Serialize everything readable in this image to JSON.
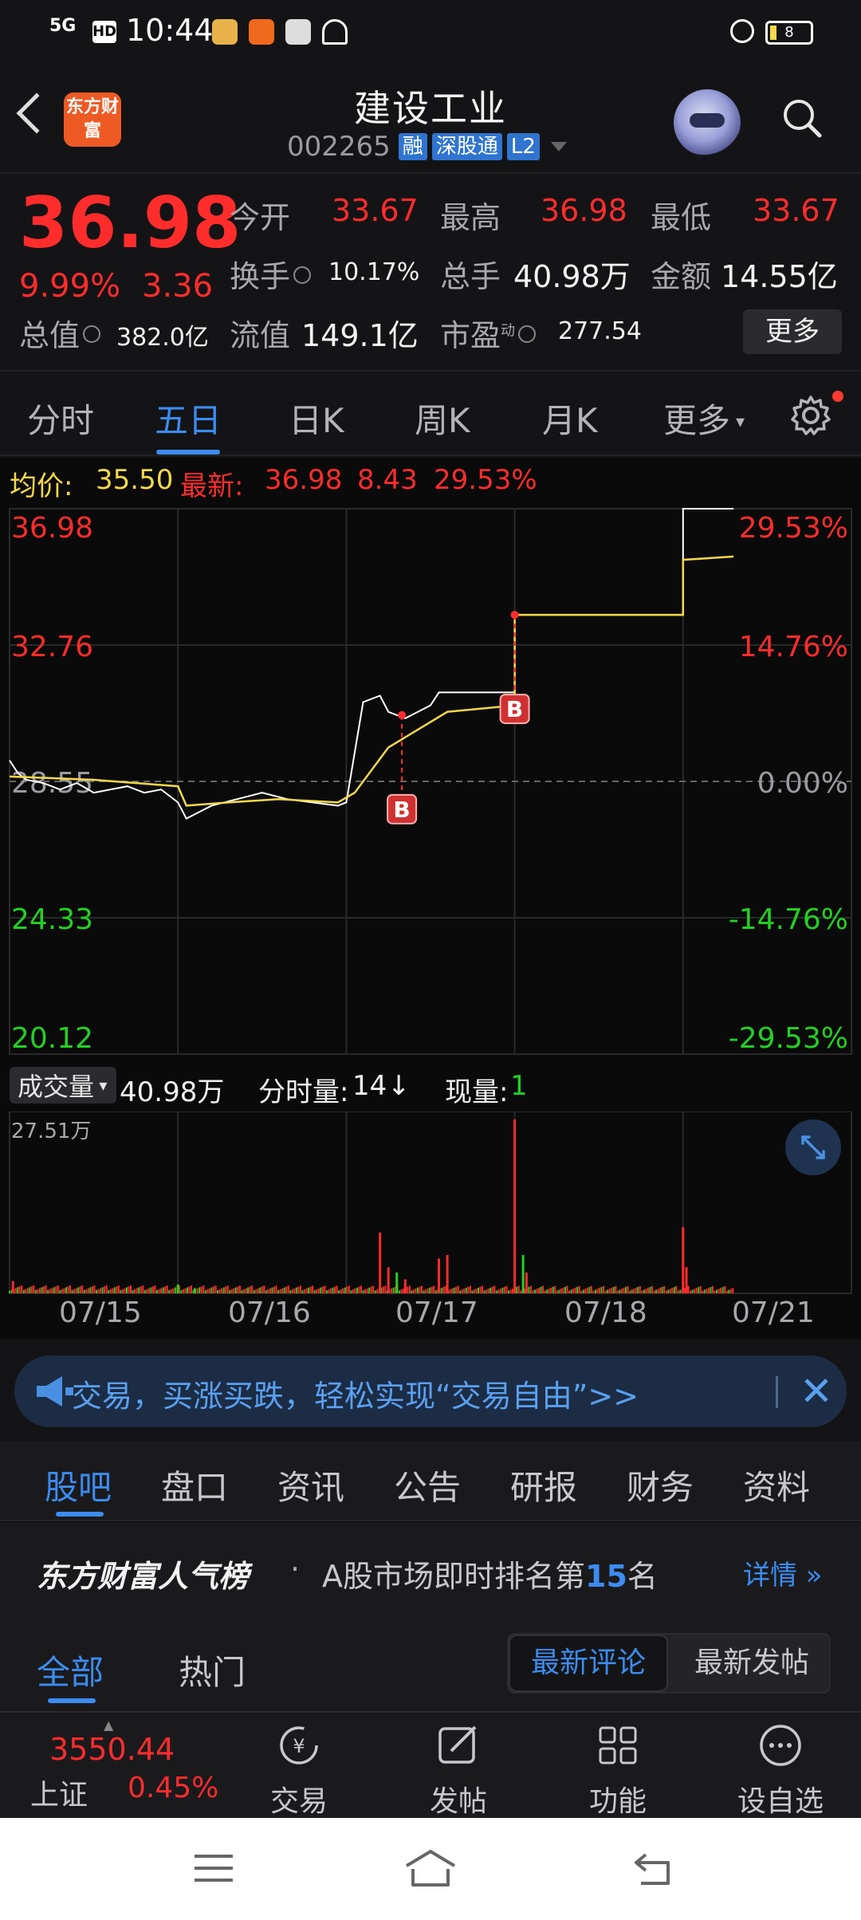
{
  "status_bar": {
    "time": "10:44",
    "network": "5G",
    "hd": "HD",
    "battery": "8"
  },
  "header": {
    "logo_text": "东方财富",
    "stock_name": "建设工业",
    "stock_code": "002265",
    "tags": [
      "融",
      "深股通",
      "L2"
    ]
  },
  "quote": {
    "price": "36.98",
    "change_pct": "9.99%",
    "change": "3.36",
    "open_label": "今开",
    "open": "33.67",
    "high_label": "最高",
    "high": "36.98",
    "low_label": "最低",
    "low": "33.67",
    "turnover_label": "换手",
    "turnover": "10.17%",
    "volume_label": "总手",
    "volume": "40.98万",
    "amount_label": "金额",
    "amount": "14.55亿",
    "mktcap_label": "总值",
    "mktcap": "382.0亿",
    "float_label": "流值",
    "float_cap": "149.1亿",
    "pe_label": "市盈",
    "pe_sup": "动",
    "pe": "277.54",
    "more_label": "更多"
  },
  "chart_tabs": [
    "分时",
    "五日",
    "日K",
    "周K",
    "月K",
    "更多"
  ],
  "chart_tabs_active": 1,
  "info_row": {
    "avg_label": "均价:",
    "avg": "35.50",
    "latest_label": "最新:",
    "latest": "36.98",
    "chg": "8.43",
    "chg_pct": "29.53%"
  },
  "chart_data": {
    "type": "line",
    "days": [
      "07/15",
      "07/16",
      "07/17",
      "07/18",
      "07/21"
    ],
    "y_left_ticks": [
      "36.98",
      "32.76",
      "28.55",
      "24.33",
      "20.12"
    ],
    "y_right_ticks": [
      "29.53%",
      "14.76%",
      "0.00%",
      "-14.76%",
      "-29.53%"
    ],
    "ylim": [
      20.12,
      36.98
    ],
    "base_price": 28.55,
    "series": [
      {
        "color": "#ffffff",
        "x": [
          0,
          0.05,
          0.1,
          0.2,
          0.3,
          0.4,
          0.5,
          0.6,
          0.7,
          0.8,
          0.9,
          1.0,
          1.05,
          1.2,
          1.35,
          1.5,
          1.65,
          1.8,
          1.95,
          2.0,
          2.1,
          2.2,
          2.25,
          2.35,
          2.5,
          2.55,
          2.7,
          2.8,
          3.0,
          3.0,
          3.5,
          4.0,
          4.0,
          4.3
        ],
        "values": [
          29.2,
          28.8,
          28.6,
          28.5,
          28.3,
          28.5,
          28.2,
          28.3,
          28.4,
          28.2,
          28.3,
          27.9,
          27.4,
          27.8,
          28.0,
          28.2,
          28.0,
          27.9,
          27.8,
          27.9,
          31.0,
          31.2,
          30.7,
          30.5,
          30.9,
          31.3,
          31.3,
          31.3,
          31.3,
          33.7,
          33.7,
          33.7,
          36.98,
          36.98
        ]
      },
      {
        "color": "#f5d949",
        "x": [
          0,
          0.5,
          1.0,
          1.05,
          1.3,
          1.6,
          1.95,
          2.05,
          2.25,
          2.6,
          3.0,
          3.0,
          3.5,
          4.0,
          4.0,
          4.3
        ],
        "values": [
          28.7,
          28.6,
          28.4,
          27.8,
          27.9,
          28.0,
          27.9,
          28.2,
          29.6,
          30.7,
          30.9,
          33.7,
          33.7,
          33.7,
          35.4,
          35.5
        ]
      }
    ],
    "markers": [
      {
        "label": "B",
        "x": 2.33,
        "value": 30.6
      },
      {
        "label": "B",
        "x": 3.0,
        "value": 33.7
      }
    ]
  },
  "volume": {
    "dropdown_label": "成交量",
    "total": "40.98万",
    "minute_vol_label": "分时量:",
    "minute_vol": "14",
    "arrow": "↓",
    "current_label": "现量:",
    "current": "1",
    "max_label": "27.51万",
    "bars": [
      {
        "x": 2.2,
        "v": 0.35,
        "c": "r"
      },
      {
        "x": 2.25,
        "v": 0.15,
        "c": "r"
      },
      {
        "x": 2.3,
        "v": 0.12,
        "c": "g"
      },
      {
        "x": 2.35,
        "v": 0.08,
        "c": "r"
      },
      {
        "x": 2.55,
        "v": 0.2,
        "c": "r"
      },
      {
        "x": 2.6,
        "v": 0.22,
        "c": "r"
      },
      {
        "x": 3.0,
        "v": 1.0,
        "c": "r"
      },
      {
        "x": 3.05,
        "v": 0.22,
        "c": "g"
      },
      {
        "x": 3.07,
        "v": 0.12,
        "c": "r"
      },
      {
        "x": 4.0,
        "v": 0.38,
        "c": "r"
      },
      {
        "x": 4.02,
        "v": 0.15,
        "c": "r"
      },
      {
        "x": 1.0,
        "v": 0.05,
        "c": "g"
      },
      {
        "x": 0.02,
        "v": 0.07,
        "c": "r"
      },
      {
        "x": 1.1,
        "v": 0.03,
        "c": "g"
      }
    ]
  },
  "banner": {
    "text": "交易，买涨买跌，轻松实现“交易自由”>>"
  },
  "section_tabs": [
    "股吧",
    "盘口",
    "资讯",
    "公告",
    "研报",
    "财务",
    "资料"
  ],
  "rank": {
    "title": "东方财富人气榜",
    "text_prefix": "A股市场即时排名第",
    "rank": "15",
    "text_suffix": "名",
    "detail": "详情"
  },
  "filter_tabs": [
    "全部",
    "热门"
  ],
  "sort_options": [
    "最新评论",
    "最新发帖"
  ],
  "bottom_nav": {
    "index_value": "3550.44",
    "index_name": "上证",
    "index_pct": "0.45%",
    "items": [
      "交易",
      "发帖",
      "功能",
      "设自选"
    ]
  },
  "colors": {
    "up": "#ff2c2c",
    "down": "#22d122",
    "accent": "#3c8cf0",
    "avg_line": "#f5d949"
  }
}
